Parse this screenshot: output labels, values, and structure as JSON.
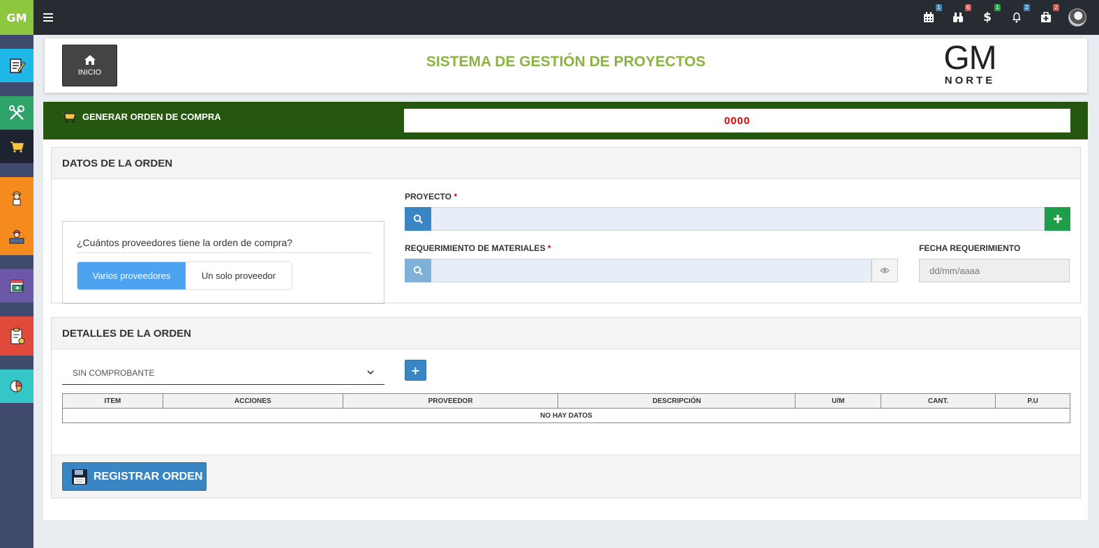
{
  "brand": "GM",
  "nav": {
    "badges": [
      {
        "icon": "calendar-icon",
        "count": "1",
        "color": "#3a86c4"
      },
      {
        "icon": "binoculars-icon",
        "count": "6",
        "color": "#d9534f"
      },
      {
        "icon": "dollar-icon",
        "count": "1",
        "color": "#28a745"
      },
      {
        "icon": "bell-icon",
        "count": "2",
        "color": "#3a86c4"
      },
      {
        "icon": "medkit-icon",
        "count": "2",
        "color": "#d9534f"
      }
    ]
  },
  "sidebar": {
    "items": [
      {
        "icon": "notepad-icon",
        "color": "#1fb6e8"
      },
      {
        "icon": "tools-icon",
        "color": "#2ea36a"
      },
      {
        "icon": "cart-icon",
        "color": "#1d2430"
      },
      {
        "icon": "worker-icon",
        "color": "#f58a1f"
      },
      {
        "icon": "worker-crowd-icon",
        "color": "#f58a1f"
      },
      {
        "icon": "money-calendar-icon",
        "color": "#6b58a8"
      },
      {
        "icon": "clipboard-icon",
        "color": "#e04a3a"
      },
      {
        "icon": "chart-icon",
        "color": "#35c7c7"
      }
    ]
  },
  "header": {
    "home_label": "INICIO",
    "title": "SISTEMA DE GESTIÓN DE PROYECTOS",
    "logo_main": "GM",
    "logo_sub": "NORTE"
  },
  "order_bar": {
    "title": "GENERAR ORDEN DE COMPRA",
    "number": "0000"
  },
  "datos": {
    "heading": "DATOS DE LA ORDEN",
    "question": "¿Cuántos proveedores tiene la orden de compra?",
    "option_multi": "Varios proveedores",
    "option_single": "Un solo proveedor",
    "proyecto_label": "PROYECTO",
    "requerimiento_label": "REQUERIMIENTO DE MATERIALES",
    "fecha_label": "FECHA REQUERIMIENTO",
    "fecha_placeholder": "dd/mm/aaaa",
    "required_mark": "*"
  },
  "detalles": {
    "heading": "DETALLES DE LA ORDEN",
    "comprobante": "SIN COMPROBANTE",
    "add_symbol": "+",
    "columns": [
      "ITEM",
      "ACCIONES",
      "PROVEEDOR",
      "DESCRIPCIÓN",
      "U/M",
      "CANT.",
      "P.U"
    ],
    "empty_text": "NO HAY DATOS",
    "register_label": "REGISTRAR ORDEN"
  }
}
